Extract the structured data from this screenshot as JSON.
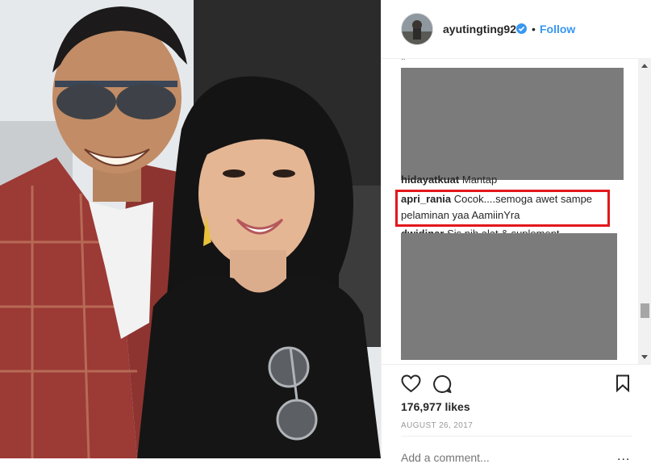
{
  "post": {
    "username": "ayutingting92",
    "verified_icon": "verified-badge-icon",
    "separator": "•",
    "follow_label": "Follow",
    "likes": "176,977 likes",
    "date": "AUGUST 26, 2017",
    "add_comment_placeholder": "Add a comment...",
    "more_label": "..."
  },
  "comments": {
    "partial_top": "’’",
    "item1": {
      "user": "hidayatkuat",
      "text": "Mantap"
    },
    "highlighted": {
      "user": "apri_rania",
      "text": "Cocok....semoga awet sampe pelaminan yaa AamiinYra"
    },
    "item3": {
      "user": "dwidinar",
      "text": "Sis nih alat & suplement"
    }
  },
  "colors": {
    "accent": "#3897f0",
    "highlight_border": "#e3171b",
    "redaction": "#7b7b7b"
  }
}
